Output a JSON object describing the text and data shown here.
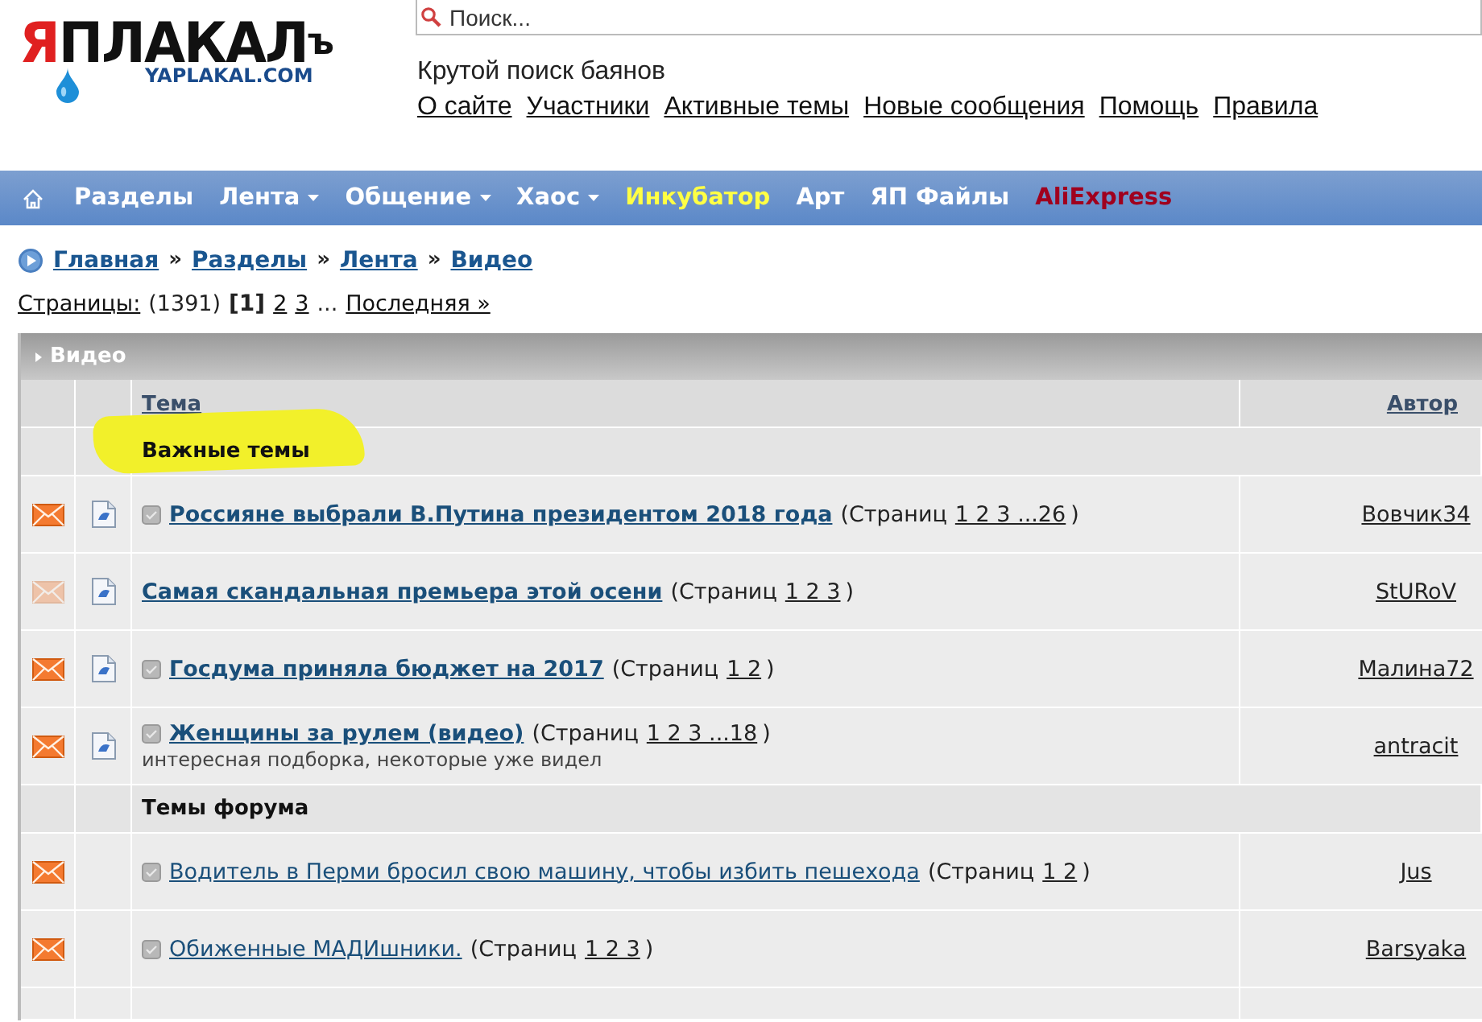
{
  "logo": {
    "title": "ЯПЛАКАЛъ",
    "subtitle": "YAPLAKAL.COM"
  },
  "search": {
    "placeholder": "Поиск..."
  },
  "tagline": "Крутой поиск баянов",
  "top_links": [
    "О сайте",
    "Участники",
    "Активные темы",
    "Новые сообщения",
    "Помощь",
    "Правила"
  ],
  "nav": [
    {
      "label": "Разделы",
      "dropdown": false,
      "color": "#ffffff"
    },
    {
      "label": "Лента",
      "dropdown": true,
      "color": "#ffffff"
    },
    {
      "label": "Общение",
      "dropdown": true,
      "color": "#ffffff"
    },
    {
      "label": "Хаос",
      "dropdown": true,
      "color": "#ffffff"
    },
    {
      "label": "Инкубатор",
      "dropdown": false,
      "color": "#ffff44"
    },
    {
      "label": "Арт",
      "dropdown": false,
      "color": "#ffffff"
    },
    {
      "label": "ЯП Файлы",
      "dropdown": false,
      "color": "#ffffff"
    },
    {
      "label": "AliExpress",
      "dropdown": false,
      "color": "#a0001e"
    }
  ],
  "breadcrumb": [
    "Главная",
    "Разделы",
    "Лента",
    "Видео"
  ],
  "breadcrumb_separator": "»",
  "pagination": {
    "label": "Страницы:",
    "total": "(1391)",
    "current": "[1]",
    "pages": [
      "2",
      "3"
    ],
    "ellipsis": "...",
    "last": "Последняя »"
  },
  "table": {
    "title": "Видео",
    "columns": [
      "Тема",
      "Автор"
    ],
    "sections": [
      {
        "title": "Важные темы",
        "highlighted": true,
        "pinned": true,
        "rows": [
          {
            "unread": true,
            "attachment": true,
            "marker": true,
            "title": "Россияне выбрали В.Путина президентом 2018 года",
            "pages_label": "(Страниц",
            "pages": "1 2 3 ...26",
            "pages_end": ")",
            "description": "",
            "author": "Вовчик34"
          },
          {
            "unread": false,
            "attachment": true,
            "marker": false,
            "title": "Самая скандальная премьера этой осени",
            "pages_label": "(Страниц",
            "pages": "1 2 3",
            "pages_end": ")",
            "description": "",
            "author": "StURoV"
          },
          {
            "unread": true,
            "attachment": true,
            "marker": true,
            "title": "Госдума приняла бюджет на 2017",
            "pages_label": "(Страниц",
            "pages": "1 2",
            "pages_end": ")",
            "description": "",
            "author": "Малина72"
          },
          {
            "unread": true,
            "attachment": true,
            "marker": true,
            "title": "Женщины за рулем (видео)",
            "pages_label": "(Страниц",
            "pages": "1 2 3 ...18",
            "pages_end": ")",
            "description": "интересная подборка, некоторые уже видел",
            "author": "antracit"
          }
        ]
      },
      {
        "title": "Темы форума",
        "highlighted": false,
        "pinned": false,
        "rows": [
          {
            "unread": true,
            "attachment": false,
            "marker": true,
            "title": "Водитель в Перми бросил свою машину, чтобы избить пешехода",
            "pages_label": "(Страниц",
            "pages": "1 2",
            "pages_end": ")",
            "description": "",
            "author": "Jus"
          },
          {
            "unread": true,
            "attachment": false,
            "marker": true,
            "title": "Обиженные МАДИшники.",
            "pages_label": "(Страниц",
            "pages": "1 2 3",
            "pages_end": ")",
            "description": "",
            "author": "Barsyaka"
          }
        ]
      }
    ]
  }
}
